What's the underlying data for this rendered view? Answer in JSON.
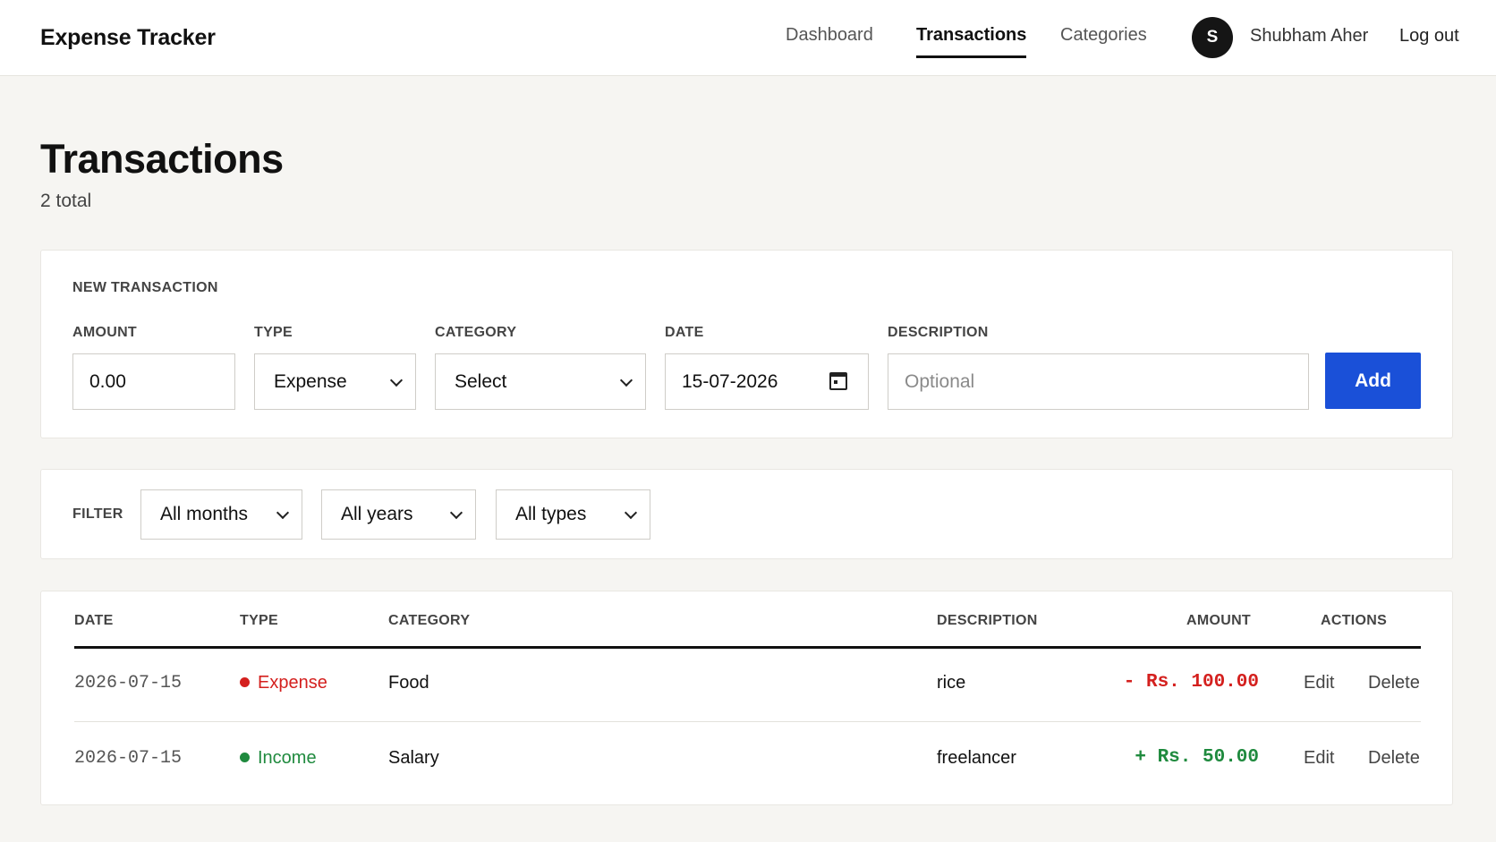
{
  "app": {
    "brand": "Expense Tracker"
  },
  "nav": {
    "items": [
      {
        "label": "Dashboard",
        "active": false
      },
      {
        "label": "Transactions",
        "active": true
      },
      {
        "label": "Categories",
        "active": false
      }
    ],
    "avatar_initial": "S",
    "username": "Shubham Aher",
    "logout_label": "Log out"
  },
  "page": {
    "title": "Transactions",
    "subtitle": "2 total"
  },
  "new_transaction": {
    "section_label": "NEW TRANSACTION",
    "amount": {
      "label": "AMOUNT",
      "value": "0.00"
    },
    "type": {
      "label": "TYPE",
      "value": "Expense"
    },
    "category": {
      "label": "CATEGORY",
      "value": "Select"
    },
    "date": {
      "label": "DATE",
      "value": "15-07-2026"
    },
    "description": {
      "label": "DESCRIPTION",
      "placeholder": "Optional"
    },
    "add_label": "Add"
  },
  "filter": {
    "label": "FILTER",
    "months": "All months",
    "years": "All years",
    "types": "All types"
  },
  "table": {
    "headers": {
      "date": "DATE",
      "type": "TYPE",
      "category": "CATEGORY",
      "description": "DESCRIPTION",
      "amount": "AMOUNT",
      "actions": "ACTIONS"
    },
    "rows": [
      {
        "date": "2026-07-15",
        "type": "Expense",
        "category": "Food",
        "description": "rice",
        "amount": "- Rs. 100.00",
        "edit": "Edit",
        "delete": "Delete"
      },
      {
        "date": "2026-07-15",
        "type": "Income",
        "category": "Salary",
        "description": "freelancer",
        "amount": "+ Rs. 50.00",
        "edit": "Edit",
        "delete": "Delete"
      }
    ]
  },
  "colors": {
    "accent": "#1a50d8",
    "expense": "#d4201e",
    "income": "#1f8a3e"
  }
}
